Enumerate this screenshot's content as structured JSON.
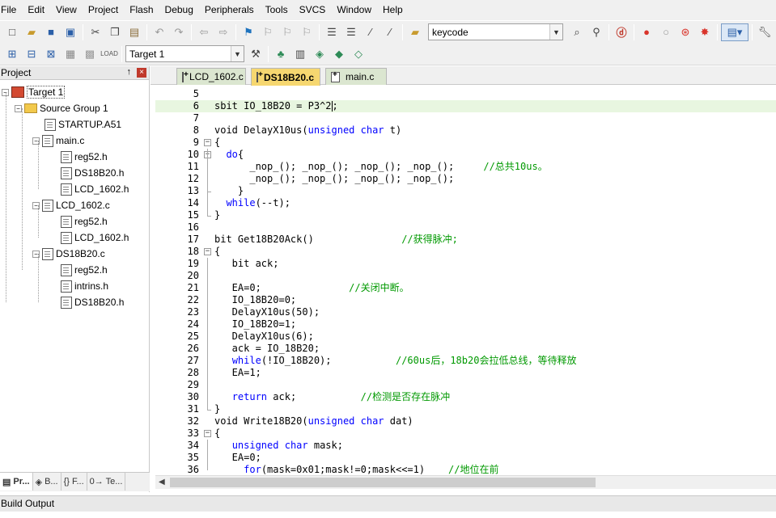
{
  "menu": [
    "File",
    "Edit",
    "View",
    "Project",
    "Flash",
    "Debug",
    "Peripherals",
    "Tools",
    "SVCS",
    "Window",
    "Help"
  ],
  "toolbar": {
    "search_combo_value": "keycode",
    "target_combo_value": "Target 1"
  },
  "project_panel": {
    "title": "Project",
    "pin_glyph": "↑",
    "close_glyph": "×",
    "tree": [
      {
        "label": "Target 1",
        "kind": "target"
      },
      {
        "label": "Source Group 1",
        "kind": "folder"
      },
      {
        "label": "STARTUP.A51",
        "kind": "file"
      },
      {
        "label": "main.c",
        "kind": "file"
      },
      {
        "label": "reg52.h",
        "kind": "file"
      },
      {
        "label": "DS18B20.h",
        "kind": "file"
      },
      {
        "label": "LCD_1602.h",
        "kind": "file"
      },
      {
        "label": "LCD_1602.c",
        "kind": "file"
      },
      {
        "label": "reg52.h",
        "kind": "file"
      },
      {
        "label": "LCD_1602.h",
        "kind": "file"
      },
      {
        "label": "DS18B20.c",
        "kind": "file"
      },
      {
        "label": "reg52.h",
        "kind": "file"
      },
      {
        "label": "intrins.h",
        "kind": "file"
      },
      {
        "label": "DS18B20.h",
        "kind": "file"
      }
    ],
    "tabs": [
      {
        "label": "Pr...",
        "icon": "▤"
      },
      {
        "label": "B...",
        "icon": "◈"
      },
      {
        "label": "{} F...",
        "icon": ""
      },
      {
        "label": "0→ Te...",
        "icon": ""
      }
    ]
  },
  "editor": {
    "tabs": [
      {
        "label": "LCD_1602.c",
        "active": false
      },
      {
        "label": "DS18B20.c",
        "active": true
      },
      {
        "label": "main.c",
        "active": false
      }
    ],
    "lines": [
      {
        "n": "5",
        "code": ""
      },
      {
        "n": "6",
        "code": "sbit IO_18B20 = P3^2;"
      },
      {
        "n": "7",
        "code": ""
      },
      {
        "n": "8",
        "code": "void DelayX10us(unsigned char t)"
      },
      {
        "n": "9",
        "code": "{"
      },
      {
        "n": "10",
        "code": "  do{"
      },
      {
        "n": "11",
        "code": "      _nop_(); _nop_(); _nop_(); _nop_();     //总共10us。"
      },
      {
        "n": "12",
        "code": "      _nop_(); _nop_(); _nop_(); _nop_();"
      },
      {
        "n": "13",
        "code": "    }"
      },
      {
        "n": "14",
        "code": "  while(--t);"
      },
      {
        "n": "15",
        "code": "}"
      },
      {
        "n": "16",
        "code": ""
      },
      {
        "n": "17",
        "code": "bit Get18B20Ack()               //获得脉冲;"
      },
      {
        "n": "18",
        "code": "{"
      },
      {
        "n": "19",
        "code": "   bit ack;"
      },
      {
        "n": "20",
        "code": ""
      },
      {
        "n": "21",
        "code": "   EA=0;               //关闭中断。"
      },
      {
        "n": "22",
        "code": "   IO_18B20=0;"
      },
      {
        "n": "23",
        "code": "   DelayX10us(50);"
      },
      {
        "n": "24",
        "code": "   IO_18B20=1;"
      },
      {
        "n": "25",
        "code": "   DelayX10us(6);"
      },
      {
        "n": "26",
        "code": "   ack = IO_18B20;"
      },
      {
        "n": "27",
        "code": "   while(!IO_18B20);           //60us后，18b20会拉低总线，等待释放"
      },
      {
        "n": "28",
        "code": "   EA=1;"
      },
      {
        "n": "29",
        "code": ""
      },
      {
        "n": "30",
        "code": "   return ack;           //检测是否存在脉冲"
      },
      {
        "n": "31",
        "code": "}"
      },
      {
        "n": "32",
        "code": "void Write18B20(unsigned char dat)"
      },
      {
        "n": "33",
        "code": "{"
      },
      {
        "n": "34",
        "code": "   unsigned char mask;"
      },
      {
        "n": "35",
        "code": "   EA=0;"
      },
      {
        "n": "36",
        "code": "     for(mask=0x01;mask!=0;mask<<=1)    //地位在前"
      }
    ]
  },
  "build_output": {
    "title": "Build Output"
  },
  "colors": {
    "keyword": "#0000ff",
    "comment": "#009900",
    "active_tab": "#f6d770",
    "inactive_tab": "#dbe6d0",
    "current_line": "#e8f6e0"
  }
}
